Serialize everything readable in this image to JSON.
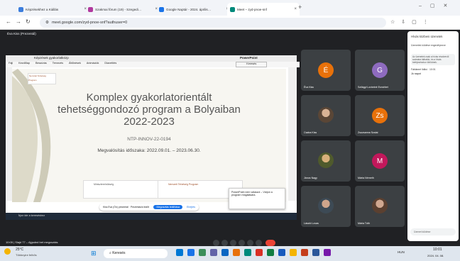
{
  "browser": {
    "tabs": [
      {
        "label": "Képzésekhez a Kiállás",
        "color": "#3b7ddd"
      },
      {
        "label": "Szakmai fórum (19) - Szegedi…",
        "color": "#b1399e"
      },
      {
        "label": "Google Naptár - 2024. április…",
        "color": "#1a73e8"
      },
      {
        "label": "Meet – zyd-pnoe-snf",
        "color": "#00897b"
      }
    ],
    "url": "meet.google.com/zyd-pnoe-snf?authuser=0",
    "new_tab": "+",
    "close": "×"
  },
  "meet": {
    "presenter_label": "Éva Kiss (Prezentál)",
    "sharing_label": "Kiss Éva (Ön) prezentál · Prezentáció leállítása",
    "stop_label": "Megosztás leállítása",
    "hide_label": "Elrejtés",
    "meeting_info": "10:05 | Slajd 77 – Ajgsdnd bet megosztás"
  },
  "ppt": {
    "title": "Képzések gyakorlatközp",
    "app_title": "PowerPoint",
    "search_placeholder": "Keresés",
    "menus": [
      "Fájl",
      "Kezdőlap",
      "Beszúrás",
      "Tervezés",
      "Áttűnések",
      "Animációk",
      "Diavetítés"
    ],
    "slide_title": "Komplex gyakorlatorientált tehetséggondozó program a Bolyaiban 2022-2023",
    "slide_title_lines": [
      "Komplex gyakorlatorientált",
      "tehetséggondozó program a Bolyaiban",
      "2022-2023"
    ],
    "code": "NTP-INNOV-22-0194",
    "period": "Megvalósítás időszaka: 2022.09.01. – 2023.06.30.",
    "logo1": "Miniszterelnökség",
    "logo2": "Nemzeti Tehetség Program",
    "note": "PowerPoint nem válaszol – Várjon a program reagálására.",
    "win_search": "Írjon ide a kereséshez"
  },
  "participants": [
    {
      "name": "Éva Kiss",
      "initial": "É",
      "color": "#e8710a"
    },
    {
      "name": "Szilágyi Lorántné Erzsébet",
      "initial": "G",
      "color": "#8e6bbf"
    },
    {
      "name": "Csaba Kiss",
      "initial": "",
      "color": "#3c4043"
    },
    {
      "name": "Zsuzsanna Szalai",
      "initial": "Zs",
      "color": "#e8710a"
    },
    {
      "name": "János Nagy",
      "initial": "",
      "color": "#3c4043"
    },
    {
      "name": "Márta Németh",
      "initial": "M",
      "color": "#c2185b"
    },
    {
      "name": "László Lovas",
      "initial": "",
      "color": "#3c4043"
    },
    {
      "name": "Mária Tóth",
      "initial": "",
      "color": "#3c4043"
    }
  ],
  "chat": {
    "title": "Hívás közbeni üzenetek",
    "toggle_label": "Üzenetek küldése engedélyezve",
    "info": "Az üzenetek csak a hívás résztvevői számára láthatók, és a hívás befejezésekor törlődnek.",
    "message_author": "Fábiánné Ildikó · 10:01",
    "message": "Jó napot",
    "input_placeholder": "Üzenet küldése"
  },
  "taskbar": {
    "weather_temp": "25°C",
    "weather_desc": "Többnyire felhős",
    "search": "Keresés",
    "time": "10:01",
    "date": "2024. 04. 08.",
    "lang": "HUN"
  }
}
